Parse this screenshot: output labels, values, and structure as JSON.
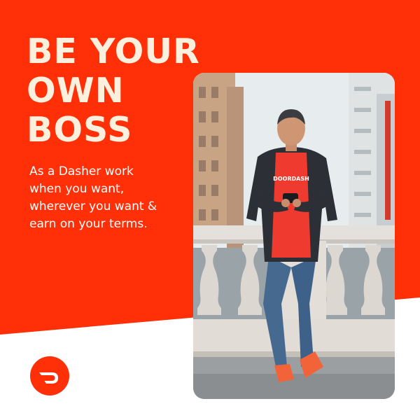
{
  "brand": {
    "name": "DoorDash",
    "accent": "#ff3008",
    "cream": "#fbf0dd"
  },
  "headline": {
    "lines": [
      "BE YOUR",
      "OWN",
      "BOSS"
    ]
  },
  "subcopy": {
    "lines": [
      "As a Dasher work",
      "when you want,",
      "wherever you want &",
      "earn on your terms."
    ]
  },
  "photo": {
    "shirt_logo_text": "DOORDASH"
  },
  "icons": {
    "logo": "doordash-logo-icon"
  }
}
